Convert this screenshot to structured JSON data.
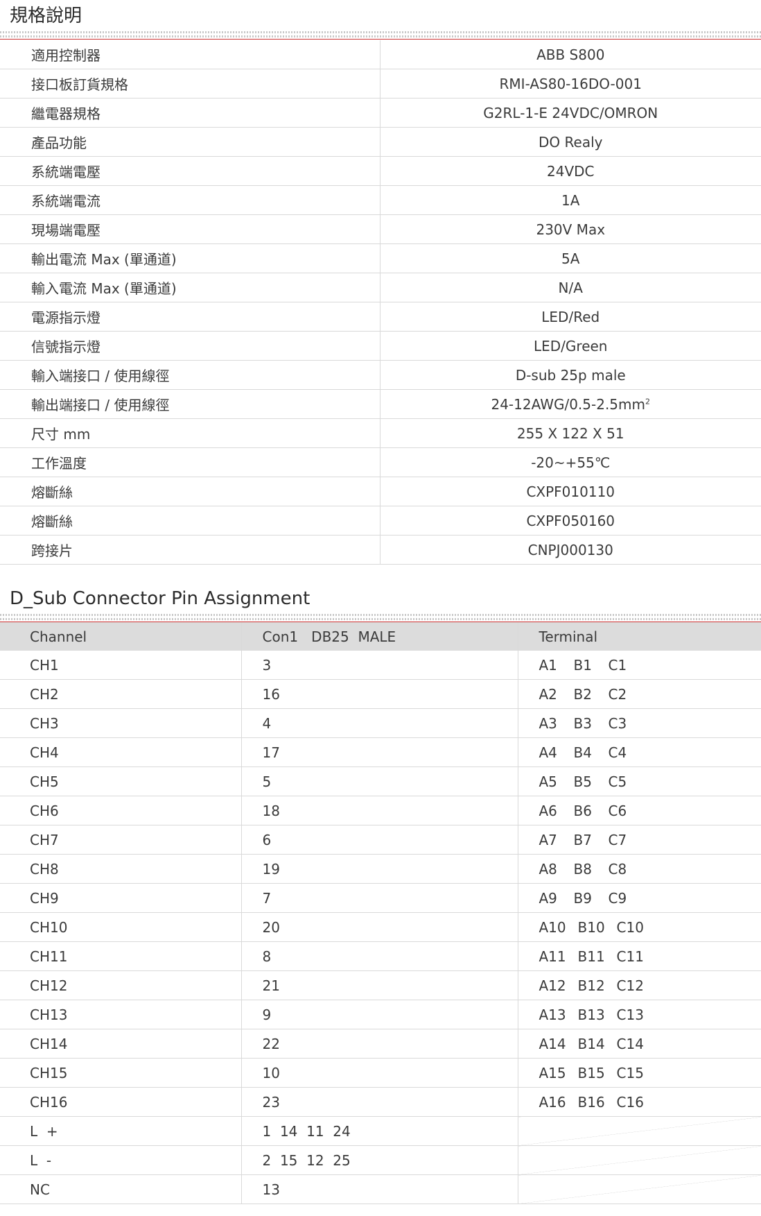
{
  "spec_section": {
    "title": "規格說明",
    "rows": [
      {
        "key": "適用控制器",
        "value": "ABB S800"
      },
      {
        "key": "接口板訂貨規格",
        "value": "RMI-AS80-16DO-001"
      },
      {
        "key": "繼電器規格",
        "value": "G2RL-1-E 24VDC/OMRON"
      },
      {
        "key": "產品功能",
        "value": "DO Realy"
      },
      {
        "key": "系統端電壓",
        "value": "24VDC"
      },
      {
        "key": "系統端電流",
        "value": "1A"
      },
      {
        "key": "現場端電壓",
        "value": "230V Max"
      },
      {
        "key": "輸出電流 Max (單通道)",
        "value": "5A"
      },
      {
        "key": "輸入電流 Max (單通道)",
        "value": "N/A"
      },
      {
        "key": "電源指示燈",
        "value": "LED/Red"
      },
      {
        "key": "信號指示燈",
        "value": "LED/Green"
      },
      {
        "key": "輸入端接口 / 使用線徑",
        "value": "D-sub 25p male"
      },
      {
        "key": "輸出端接口 / 使用線徑",
        "value": "24-12AWG/0.5-2.5mm",
        "sup": "2"
      },
      {
        "key": "尺寸 mm",
        "value": "255 X 122 X 51"
      },
      {
        "key": "工作溫度",
        "value": "-20~+55℃"
      },
      {
        "key": "熔斷絲",
        "value": "CXPF010110"
      },
      {
        "key": "熔斷絲",
        "value": "CXPF050160"
      },
      {
        "key": "跨接片",
        "value": "CNPJ000130"
      }
    ]
  },
  "pin_section": {
    "title": "D_Sub  Connector  Pin Assignment",
    "headers": [
      "Channel",
      "Con1   DB25  MALE",
      "Terminal"
    ],
    "rows": [
      {
        "channel": "CH1",
        "pin": "3",
        "terminals": [
          "A1",
          "B1",
          "C1"
        ]
      },
      {
        "channel": "CH2",
        "pin": "16",
        "terminals": [
          "A2",
          "B2",
          "C2"
        ]
      },
      {
        "channel": "CH3",
        "pin": "4",
        "terminals": [
          "A3",
          "B3",
          "C3"
        ]
      },
      {
        "channel": "CH4",
        "pin": "17",
        "terminals": [
          "A4",
          "B4",
          "C4"
        ]
      },
      {
        "channel": "CH5",
        "pin": "5",
        "terminals": [
          "A5",
          "B5",
          "C5"
        ]
      },
      {
        "channel": "CH6",
        "pin": "18",
        "terminals": [
          "A6",
          "B6",
          "C6"
        ]
      },
      {
        "channel": "CH7",
        "pin": "6",
        "terminals": [
          "A7",
          "B7",
          "C7"
        ]
      },
      {
        "channel": "CH8",
        "pin": "19",
        "terminals": [
          "A8",
          "B8",
          "C8"
        ]
      },
      {
        "channel": "CH9",
        "pin": "7",
        "terminals": [
          "A9",
          "B9",
          "C9"
        ]
      },
      {
        "channel": "CH10",
        "pin": "20",
        "terminals": [
          "A10",
          "B10",
          "C10"
        ]
      },
      {
        "channel": "CH11",
        "pin": "8",
        "terminals": [
          "A11",
          "B11",
          "C11"
        ]
      },
      {
        "channel": "CH12",
        "pin": "21",
        "terminals": [
          "A12",
          "B12",
          "C12"
        ]
      },
      {
        "channel": "CH13",
        "pin": "9",
        "terminals": [
          "A13",
          "B13",
          "C13"
        ]
      },
      {
        "channel": "CH14",
        "pin": "22",
        "terminals": [
          "A14",
          "B14",
          "C14"
        ]
      },
      {
        "channel": "CH15",
        "pin": "10",
        "terminals": [
          "A15",
          "B15",
          "C15"
        ]
      },
      {
        "channel": "CH16",
        "pin": "23",
        "terminals": [
          "A16",
          "B16",
          "C16"
        ]
      },
      {
        "channel": "L  +",
        "pin": "1  14  11  24",
        "terminals": []
      },
      {
        "channel": "L  -",
        "pin": "2  15  12  25",
        "terminals": []
      },
      {
        "channel": "NC",
        "pin": "13",
        "terminals": []
      }
    ]
  }
}
